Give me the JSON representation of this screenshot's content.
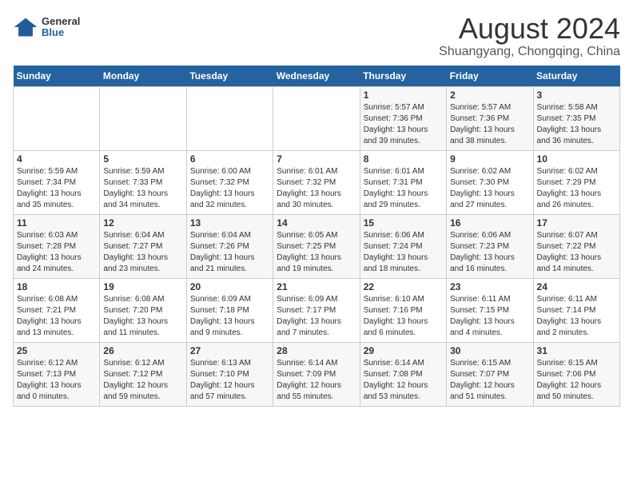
{
  "logo": {
    "general": "General",
    "blue": "Blue"
  },
  "header": {
    "month": "August 2024",
    "location": "Shuangyang, Chongqing, China"
  },
  "weekdays": [
    "Sunday",
    "Monday",
    "Tuesday",
    "Wednesday",
    "Thursday",
    "Friday",
    "Saturday"
  ],
  "weeks": [
    [
      {
        "day": "",
        "info": ""
      },
      {
        "day": "",
        "info": ""
      },
      {
        "day": "",
        "info": ""
      },
      {
        "day": "",
        "info": ""
      },
      {
        "day": "1",
        "info": "Sunrise: 5:57 AM\nSunset: 7:36 PM\nDaylight: 13 hours\nand 39 minutes."
      },
      {
        "day": "2",
        "info": "Sunrise: 5:57 AM\nSunset: 7:36 PM\nDaylight: 13 hours\nand 38 minutes."
      },
      {
        "day": "3",
        "info": "Sunrise: 5:58 AM\nSunset: 7:35 PM\nDaylight: 13 hours\nand 36 minutes."
      }
    ],
    [
      {
        "day": "4",
        "info": "Sunrise: 5:59 AM\nSunset: 7:34 PM\nDaylight: 13 hours\nand 35 minutes."
      },
      {
        "day": "5",
        "info": "Sunrise: 5:59 AM\nSunset: 7:33 PM\nDaylight: 13 hours\nand 34 minutes."
      },
      {
        "day": "6",
        "info": "Sunrise: 6:00 AM\nSunset: 7:32 PM\nDaylight: 13 hours\nand 32 minutes."
      },
      {
        "day": "7",
        "info": "Sunrise: 6:01 AM\nSunset: 7:32 PM\nDaylight: 13 hours\nand 30 minutes."
      },
      {
        "day": "8",
        "info": "Sunrise: 6:01 AM\nSunset: 7:31 PM\nDaylight: 13 hours\nand 29 minutes."
      },
      {
        "day": "9",
        "info": "Sunrise: 6:02 AM\nSunset: 7:30 PM\nDaylight: 13 hours\nand 27 minutes."
      },
      {
        "day": "10",
        "info": "Sunrise: 6:02 AM\nSunset: 7:29 PM\nDaylight: 13 hours\nand 26 minutes."
      }
    ],
    [
      {
        "day": "11",
        "info": "Sunrise: 6:03 AM\nSunset: 7:28 PM\nDaylight: 13 hours\nand 24 minutes."
      },
      {
        "day": "12",
        "info": "Sunrise: 6:04 AM\nSunset: 7:27 PM\nDaylight: 13 hours\nand 23 minutes."
      },
      {
        "day": "13",
        "info": "Sunrise: 6:04 AM\nSunset: 7:26 PM\nDaylight: 13 hours\nand 21 minutes."
      },
      {
        "day": "14",
        "info": "Sunrise: 6:05 AM\nSunset: 7:25 PM\nDaylight: 13 hours\nand 19 minutes."
      },
      {
        "day": "15",
        "info": "Sunrise: 6:06 AM\nSunset: 7:24 PM\nDaylight: 13 hours\nand 18 minutes."
      },
      {
        "day": "16",
        "info": "Sunrise: 6:06 AM\nSunset: 7:23 PM\nDaylight: 13 hours\nand 16 minutes."
      },
      {
        "day": "17",
        "info": "Sunrise: 6:07 AM\nSunset: 7:22 PM\nDaylight: 13 hours\nand 14 minutes."
      }
    ],
    [
      {
        "day": "18",
        "info": "Sunrise: 6:08 AM\nSunset: 7:21 PM\nDaylight: 13 hours\nand 13 minutes."
      },
      {
        "day": "19",
        "info": "Sunrise: 6:08 AM\nSunset: 7:20 PM\nDaylight: 13 hours\nand 11 minutes."
      },
      {
        "day": "20",
        "info": "Sunrise: 6:09 AM\nSunset: 7:18 PM\nDaylight: 13 hours\nand 9 minutes."
      },
      {
        "day": "21",
        "info": "Sunrise: 6:09 AM\nSunset: 7:17 PM\nDaylight: 13 hours\nand 7 minutes."
      },
      {
        "day": "22",
        "info": "Sunrise: 6:10 AM\nSunset: 7:16 PM\nDaylight: 13 hours\nand 6 minutes."
      },
      {
        "day": "23",
        "info": "Sunrise: 6:11 AM\nSunset: 7:15 PM\nDaylight: 13 hours\nand 4 minutes."
      },
      {
        "day": "24",
        "info": "Sunrise: 6:11 AM\nSunset: 7:14 PM\nDaylight: 13 hours\nand 2 minutes."
      }
    ],
    [
      {
        "day": "25",
        "info": "Sunrise: 6:12 AM\nSunset: 7:13 PM\nDaylight: 13 hours\nand 0 minutes."
      },
      {
        "day": "26",
        "info": "Sunrise: 6:12 AM\nSunset: 7:12 PM\nDaylight: 12 hours\nand 59 minutes."
      },
      {
        "day": "27",
        "info": "Sunrise: 6:13 AM\nSunset: 7:10 PM\nDaylight: 12 hours\nand 57 minutes."
      },
      {
        "day": "28",
        "info": "Sunrise: 6:14 AM\nSunset: 7:09 PM\nDaylight: 12 hours\nand 55 minutes."
      },
      {
        "day": "29",
        "info": "Sunrise: 6:14 AM\nSunset: 7:08 PM\nDaylight: 12 hours\nand 53 minutes."
      },
      {
        "day": "30",
        "info": "Sunrise: 6:15 AM\nSunset: 7:07 PM\nDaylight: 12 hours\nand 51 minutes."
      },
      {
        "day": "31",
        "info": "Sunrise: 6:15 AM\nSunset: 7:06 PM\nDaylight: 12 hours\nand 50 minutes."
      }
    ]
  ]
}
